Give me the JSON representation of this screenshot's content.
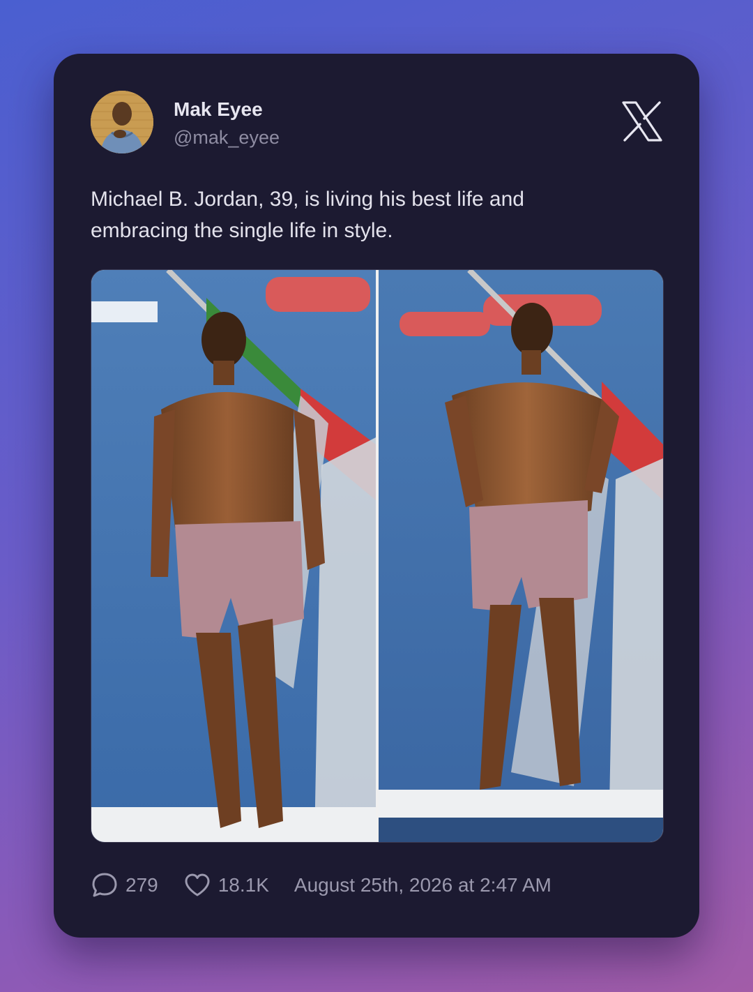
{
  "author": {
    "name": "Mak Eyee",
    "handle": "@mak_eyee",
    "avatar_icon": "profile-photo"
  },
  "platform_icon": "x-logo-icon",
  "tweet": {
    "text_line1": "Michael B. Jordan, 39, is living his best life and",
    "text_line2": "embracing the single life in style."
  },
  "media": {
    "images": [
      "photo-man-on-boat-walking",
      "photo-man-on-boat-standing"
    ]
  },
  "footer": {
    "replies": "279",
    "likes": "18.1K",
    "timestamp": "August 25th, 2026 at 2:47 AM"
  },
  "colors": {
    "background_start": "#4a5fd0",
    "background_end": "#a25ca8",
    "card": "#1c1a31",
    "primary_text": "#e7e6f0",
    "muted_text": "#8f8da3"
  }
}
